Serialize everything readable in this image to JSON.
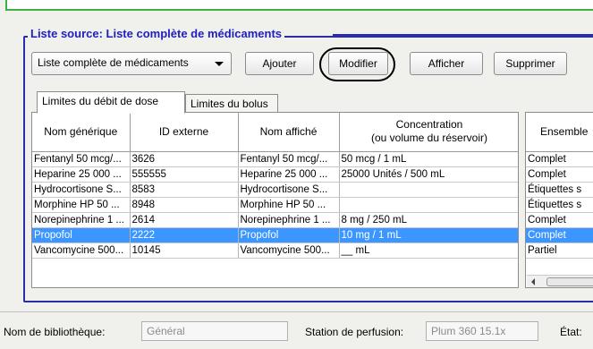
{
  "section_title": "Liste source: Liste complète de médicaments",
  "source_select": {
    "value": "Liste complète de médicaments"
  },
  "buttons": {
    "add": "Ajouter",
    "modify": "Modifier",
    "show": "Afficher",
    "delete": "Supprimer"
  },
  "tabs": {
    "dose_rate": "Limites du débit de dose",
    "bolus": "Limites du bolus"
  },
  "columns": {
    "generic": "Nom générique",
    "external_id": "ID externe",
    "display_name": "Nom affiché",
    "concentration_line1": "Concentration",
    "concentration_line2": "(ou volume du réservoir)",
    "set": "Ensemble"
  },
  "rows": [
    {
      "generic": "Fentanyl 50 mcg/...",
      "external_id": "3626",
      "display_name": "Fentanyl 50 mcg/...",
      "concentration": "50 mcg / 1 mL",
      "set": "Complet",
      "selected": false
    },
    {
      "generic": "Heparine 25 000  ...",
      "external_id": "555555",
      "display_name": "Heparine 25 000  ...",
      "concentration": "25000 Unités / 500 mL",
      "set": "Complet",
      "selected": false
    },
    {
      "generic": "Hydrocortisone S...",
      "external_id": "8583",
      "display_name": "Hydrocortisone S...",
      "concentration": "",
      "set": "Étiquettes s",
      "selected": false
    },
    {
      "generic": "Morphine HP  50 ...",
      "external_id": "8948",
      "display_name": "Morphine HP  50 ...",
      "concentration": "",
      "set": "Étiquettes s",
      "selected": false
    },
    {
      "generic": "Norepinephrine 1 ...",
      "external_id": "2614",
      "display_name": "Norepinephrine 1 ...",
      "concentration": "8 mg / 250 mL",
      "set": "Complet",
      "selected": false
    },
    {
      "generic": "Propofol",
      "external_id": "2222",
      "display_name": "Propofol",
      "concentration": "10 mg / 1 mL",
      "set": "Complet",
      "selected": true
    },
    {
      "generic": "Vancomycine  500...",
      "external_id": "10145",
      "display_name": "Vancomycine  500...",
      "concentration": "__ mL",
      "set": "Partiel",
      "selected": false
    }
  ],
  "footer": {
    "library_label": "Nom de bibliothèque:",
    "library_value": "Général",
    "station_label": "Station de perfusion:",
    "station_value": "Plum 360 15.1x",
    "state_label": "État:"
  },
  "colors": {
    "selection": "#3c96ff",
    "group_border": "#2a2ea6",
    "title_text": "#2020c0",
    "top_border": "#3cb044"
  }
}
